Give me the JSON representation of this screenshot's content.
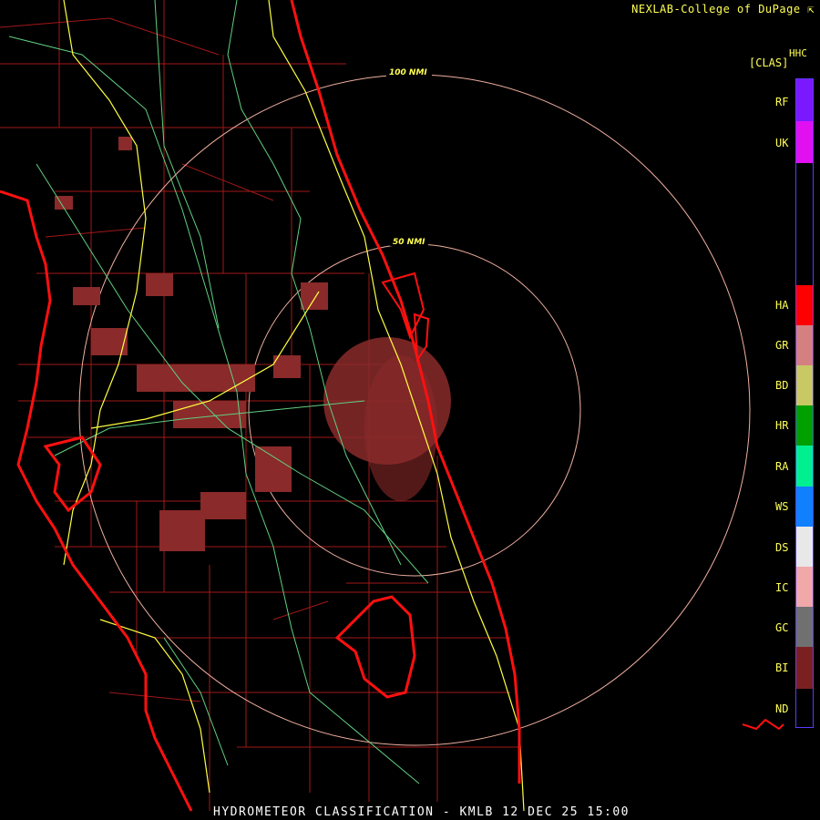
{
  "header": {
    "credit": "NEXLAB-College of DuPage"
  },
  "legend": {
    "product_code": "HHC",
    "product_abbrev": "[CLAS]",
    "items": [
      {
        "label": "RF",
        "color": "#7a18ff"
      },
      {
        "label": "UK",
        "color": "#e010f0"
      },
      {
        "label": "HA",
        "color": "#ff0000"
      },
      {
        "label": "GR",
        "color": "#d48080"
      },
      {
        "label": "BD",
        "color": "#c8c864"
      },
      {
        "label": "HR",
        "color": "#00a000"
      },
      {
        "label": "RA",
        "color": "#00f090"
      },
      {
        "label": "WS",
        "color": "#1080ff"
      },
      {
        "label": "DS",
        "color": "#e8e8e8"
      },
      {
        "label": "IC",
        "color": "#f0a8a8"
      },
      {
        "label": "GC",
        "color": "#707070"
      },
      {
        "label": "BI",
        "color": "#7a2020"
      },
      {
        "label": "ND",
        "color": "#000000"
      }
    ]
  },
  "map": {
    "ring_labels": [
      "100 NMI",
      "50 NMI"
    ],
    "colors": {
      "coast": "#ff1010",
      "county": "#a01818",
      "highway": "#ffff40",
      "road": "#60d080",
      "ring": "#f0b0a0",
      "echo": "#8a2a2a"
    }
  },
  "footer": {
    "title": "HYDROMETEOR CLASSIFICATION - KMLB 12 DEC 25 15:00"
  }
}
